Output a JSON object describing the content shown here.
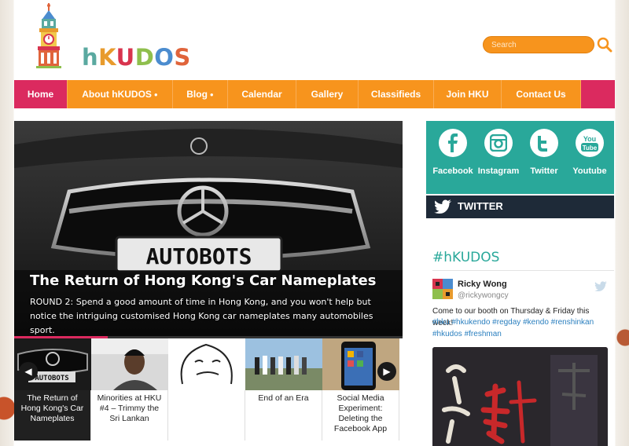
{
  "brand": {
    "logo_letters": [
      "h",
      "K",
      "U",
      "D",
      "O",
      "S"
    ]
  },
  "search": {
    "placeholder": "Search"
  },
  "nav": {
    "items": [
      {
        "label": "Home",
        "active": true
      },
      {
        "label": "About hKUDOS",
        "dropdown": true
      },
      {
        "label": "Blog",
        "dropdown": true
      },
      {
        "label": "Calendar"
      },
      {
        "label": "Gallery"
      },
      {
        "label": "Classifieds"
      },
      {
        "label": "Join HKU"
      },
      {
        "label": "Contact Us"
      }
    ],
    "dropdown_glyph": "●"
  },
  "slider": {
    "title": "The Return of Hong Kong's Car Nameplates",
    "text": "ROUND 2: Spend a good amount of time in Hong Kong, and you won't help but notice the intriguing customised Hong Kong car nameplates many automobiles sport.",
    "plate_text": "AUTOBOTS",
    "progress": 0.24,
    "prev_glyph": "◀",
    "next_glyph": "▶",
    "thumbs": [
      {
        "label": "The Return of Hong Kong's Car Nameplates",
        "active": true
      },
      {
        "label": "Minorities at HKU #4 – Trimmy the Sri Lankan"
      },
      {
        "label": ""
      },
      {
        "label": "End of an Era"
      },
      {
        "label": "Social Media Experiment: Deleting the Facebook App"
      }
    ],
    "thumb_plate_text": "AUTOBOTS"
  },
  "social": {
    "items": [
      {
        "label": "Facebook",
        "icon": "facebook-icon"
      },
      {
        "label": "Instagram",
        "icon": "instagram-icon"
      },
      {
        "label": "Twitter",
        "icon": "twitter-icon"
      },
      {
        "label": "Youtube",
        "icon": "youtube-icon"
      }
    ],
    "youtube_top": "You",
    "youtube_bottom": "Tube",
    "twitter_bar_label": "TWITTER"
  },
  "widget": {
    "title": "#hKUDOS",
    "tweet": {
      "name": "Ricky Wong",
      "handle": "@rickywongcy",
      "text": "Come to our booth on Thursday & Friday this week!",
      "hashtags": "#hku #hkukendo #regday #kendo #renshinkan #hkudos #freshman"
    }
  },
  "colors": {
    "accent_orange": "#f7941d",
    "active_pink": "#db2a5f",
    "teal": "#29a89a",
    "dark_navy": "#1e2a38"
  }
}
